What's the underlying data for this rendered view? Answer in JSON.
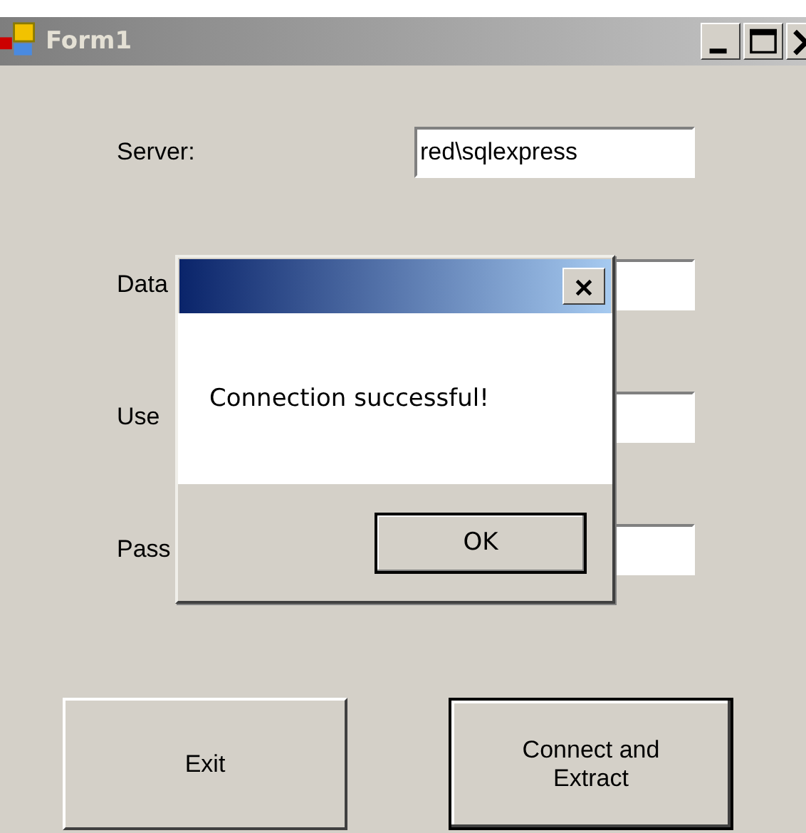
{
  "window": {
    "title": "Form1"
  },
  "fields": [
    {
      "label": "Server:",
      "value": "red\\sqlexpress"
    },
    {
      "label": "Data"
    },
    {
      "label": "Use"
    },
    {
      "label": "Pass"
    }
  ],
  "buttons": [
    {
      "label": "Exit",
      "default": false
    },
    {
      "label": "Connect and Extract",
      "default": true
    }
  ],
  "dialog": {
    "message": "Connection successful!",
    "button": "OK"
  }
}
